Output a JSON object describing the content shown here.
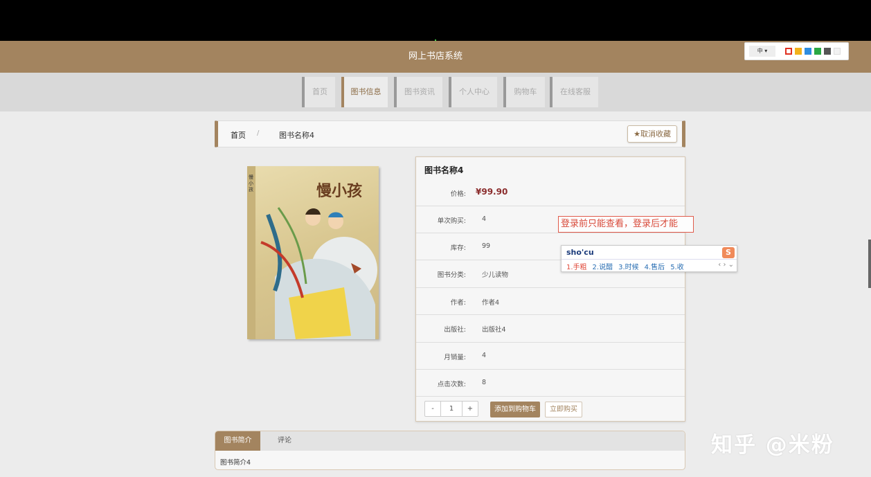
{
  "header": {
    "title": "网上书店系统"
  },
  "toolbar_widget": {
    "lang": "中 ▾",
    "swatches": [
      "#e03020",
      "#f2b21c",
      "#2e8de0",
      "#2aa843",
      "#555555",
      "#f2f2f2"
    ]
  },
  "nav": {
    "items": [
      {
        "label": "首页"
      },
      {
        "label": "图书信息"
      },
      {
        "label": "图书资讯"
      },
      {
        "label": "个人中心"
      },
      {
        "label": "购物车"
      },
      {
        "label": "在线客服"
      }
    ],
    "active_index": 1
  },
  "breadcrumb": {
    "home": "首页",
    "separator": "/",
    "current": "图书名称4"
  },
  "favorite": {
    "icon": "star-icon",
    "label": "取消收藏"
  },
  "cover": {
    "title": "慢小孩",
    "vertical_title": "慢小孩"
  },
  "book": {
    "name": "图书名称4",
    "price_label": "价格:",
    "price": "¥99.90",
    "fields": [
      {
        "label": "单次购买:",
        "value": "4"
      },
      {
        "label": "库存:",
        "value": "99"
      },
      {
        "label": "图书分类:",
        "value": "少儿读物"
      },
      {
        "label": "作者:",
        "value": "作者4"
      },
      {
        "label": "出版社:",
        "value": "出版社4"
      },
      {
        "label": "月销量:",
        "value": "4"
      },
      {
        "label": "点击次数:",
        "value": "8"
      }
    ]
  },
  "quantity": {
    "minus": "-",
    "value": "1",
    "plus": "+"
  },
  "actions": {
    "add_to_cart": "添加到购物车",
    "buy_now": "立即购买"
  },
  "tooltip": {
    "text": "登录前只能查看，登录后才能"
  },
  "ime": {
    "input": "sho'cu",
    "candidates": [
      "1.手粗",
      "2.说醋",
      "3.时候",
      "4.售后",
      "5.收"
    ],
    "logo": "S",
    "nav": "‹ › ⌄"
  },
  "tabs": {
    "items": [
      {
        "label": "图书简介"
      },
      {
        "label": "评论"
      }
    ],
    "content": "图书简介4"
  },
  "watermark": "知乎 @米粉"
}
